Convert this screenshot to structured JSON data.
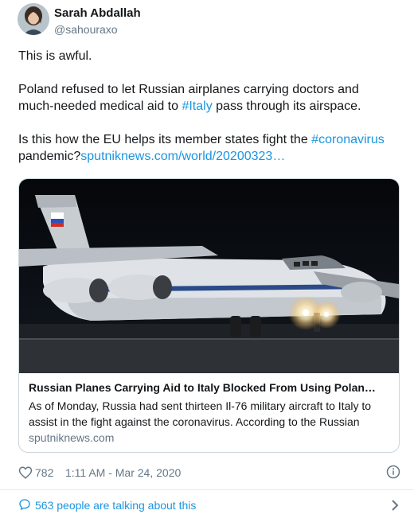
{
  "author": {
    "name": "Sarah Abdallah",
    "handle": "@sahouraxo"
  },
  "tweet": {
    "paragraph1": "This is awful.",
    "paragraph2_pre": "Poland refused to let Russian airplanes carrying doctors and much-needed medical aid to ",
    "paragraph2_hashtag": "#Italy",
    "paragraph2_post": " pass through its airspace.",
    "paragraph3_pre": "Is this how the EU helps its member states fight the ",
    "paragraph3_hashtag": "#coronavirus",
    "paragraph3_mid": " pandemic?",
    "paragraph3_link": "sputniknews.com/world/20200323…"
  },
  "card": {
    "title": "Russian Planes Carrying Aid to Italy Blocked From Using Polan…",
    "description": "As of Monday, Russia had sent thirteen Il-76 military aircraft to Italy to assist in the fight against the coronavirus. According to the Russian",
    "domain": "sputniknews.com",
    "image_icon": "russian-il76-aircraft-photo"
  },
  "meta": {
    "likes": "782",
    "timestamp": "1:11 AM - Mar 24, 2020",
    "like_icon": "heart-icon",
    "info_icon": "info-icon"
  },
  "footer": {
    "talking": "563 people are talking about this",
    "talk_icon": "speech-bubble-icon",
    "chevron_icon": "chevron-right-icon"
  },
  "colors": {
    "link": "#1b95e0",
    "secondary_text": "#657786",
    "border": "#ccd6dd"
  }
}
